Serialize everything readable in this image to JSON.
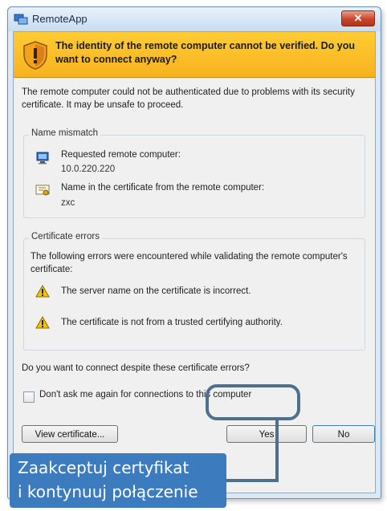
{
  "window": {
    "title": "RemoteApp",
    "close_symbol": "✕"
  },
  "banner": {
    "message": "The identity of the remote computer cannot be verified. Do you want to connect anyway?"
  },
  "intro_text": "The remote computer could not be authenticated due to problems with its security certificate. It may be unsafe to proceed.",
  "name_mismatch": {
    "label": "Name mismatch",
    "requested_label": "Requested remote computer:",
    "requested_value": "10.0.220.220",
    "cert_name_label": "Name in the certificate from the remote computer:",
    "cert_name_value": "zxc"
  },
  "certificate_errors": {
    "label": "Certificate errors",
    "description": "The following errors were encountered while validating the remote computer's certificate:",
    "errors": [
      "The server name on the certificate is incorrect.",
      "The certificate is not from a trusted certifying authority."
    ]
  },
  "question": "Do you want to connect despite these certificate errors?",
  "checkbox": {
    "label": "Don't ask me again for connections to this computer",
    "checked": false
  },
  "buttons": {
    "view_certificate": "View certificate...",
    "yes": "Yes",
    "no": "No"
  },
  "callout": {
    "line1": "Zaakceptuj certyfikat",
    "line2": "i kontynuuj połączenie"
  },
  "colors": {
    "banner": "#f7b21f",
    "callout": "#3d7bbf",
    "highlight": "#4f6f8f"
  }
}
